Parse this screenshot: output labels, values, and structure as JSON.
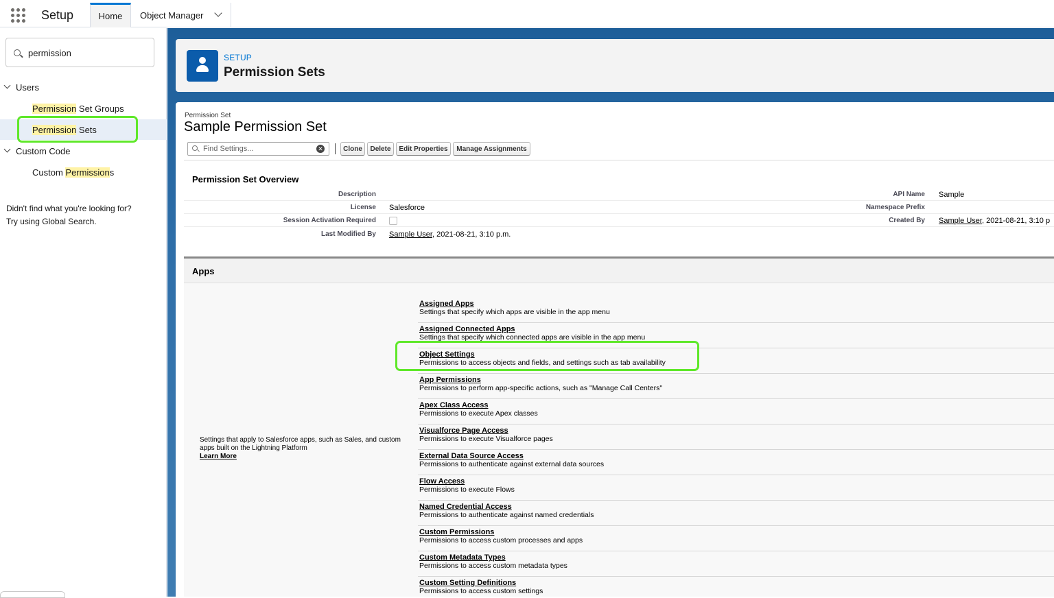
{
  "topbar": {
    "app_name": "Setup",
    "tabs": [
      {
        "label": "Home"
      },
      {
        "label": "Object Manager"
      }
    ]
  },
  "sidebar": {
    "search_value": "permission",
    "groups": [
      {
        "label": "Users",
        "items": [
          {
            "match": "Permission",
            "rest": " Set Groups"
          },
          {
            "match": "Permission",
            "rest": " Sets"
          }
        ]
      },
      {
        "label": "Custom Code",
        "items": [
          {
            "pre": "Custom ",
            "match": "Permission",
            "rest": "s"
          }
        ]
      }
    ],
    "not_found_line1": "Didn't find what you're looking for?",
    "not_found_line2": "Try using Global Search."
  },
  "header": {
    "kicker": "SETUP",
    "title": "Permission Sets",
    "icon": "user-icon"
  },
  "permission_set": {
    "kicker": "Permission Set",
    "title": "Sample Permission Set"
  },
  "toolbar": {
    "find_placeholder": "Find Settings...",
    "buttons": [
      "Clone",
      "Delete",
      "Edit Properties",
      "Manage Assignments"
    ]
  },
  "overview": {
    "title": "Permission Set Overview",
    "left": [
      {
        "label": "Description",
        "value": ""
      },
      {
        "label": "License",
        "value": "Salesforce"
      },
      {
        "label": "Session Activation Required",
        "value": ""
      },
      {
        "label": "Last Modified By",
        "link": "Sample User",
        "value": ", 2021-08-21, 3:10 p.m."
      }
    ],
    "right": [
      {
        "label": "API Name",
        "value": "Sample"
      },
      {
        "label": "Namespace Prefix",
        "value": ""
      },
      {
        "label": "Created By",
        "link": "Sample User",
        "value": ", 2021-08-21, 3:10 p"
      }
    ]
  },
  "apps": {
    "title": "Apps",
    "description": "Settings that apply to Salesforce apps, such as Sales, and custom apps built on the Lightning Platform",
    "learn_more": "Learn More",
    "items": [
      {
        "title": "Assigned Apps",
        "desc": "Settings that specify which apps are visible in the app menu"
      },
      {
        "title": "Assigned Connected Apps",
        "desc": "Settings that specify which connected apps are visible in the app menu"
      },
      {
        "title": "Object Settings",
        "desc": "Permissions to access objects and fields, and settings such as tab availability"
      },
      {
        "title": "App Permissions",
        "desc": "Permissions to perform app-specific actions, such as \"Manage Call Centers\""
      },
      {
        "title": "Apex Class Access",
        "desc": "Permissions to execute Apex classes"
      },
      {
        "title": "Visualforce Page Access",
        "desc": "Permissions to execute Visualforce pages"
      },
      {
        "title": "External Data Source Access",
        "desc": "Permissions to authenticate against external data sources"
      },
      {
        "title": "Flow Access",
        "desc": "Permissions to execute Flows"
      },
      {
        "title": "Named Credential Access",
        "desc": "Permissions to authenticate against named credentials"
      },
      {
        "title": "Custom Permissions",
        "desc": "Permissions to access custom processes and apps"
      },
      {
        "title": "Custom Metadata Types",
        "desc": "Permissions to access custom metadata types"
      },
      {
        "title": "Custom Setting Definitions",
        "desc": "Permissions to access custom settings"
      }
    ]
  },
  "colors": {
    "highlight_box": "#5fe82a",
    "brand_blue": "#0176d3",
    "search_match": "#fff3a6"
  }
}
